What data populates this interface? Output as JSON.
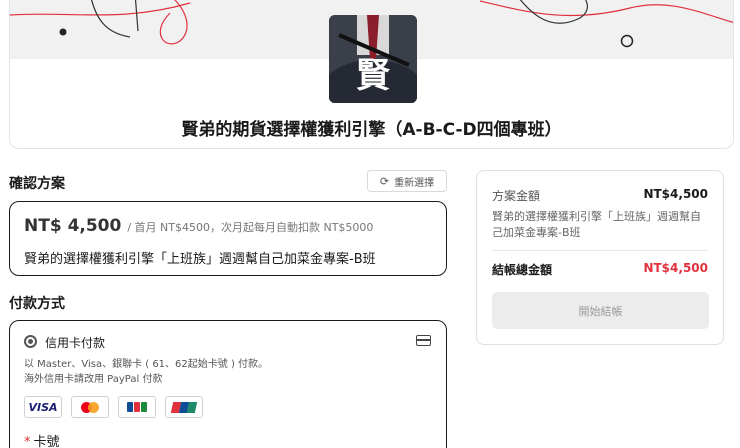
{
  "colors": {
    "accent_red": "#e0313d",
    "card_border": "#1a1a1a",
    "muted_bg": "#ececec"
  },
  "course": {
    "cover_glyph": "賢",
    "title": "賢弟的期貨選擇權獲利引擎（A-B-C-D四個專班）"
  },
  "confirm": {
    "section_title": "確認方案",
    "reselect_label": "重新選擇",
    "reselect_icon": "refresh-icon",
    "plan": {
      "price": "NT$ 4,500",
      "price_note": "/ 首月 NT$4500，次月起每月自動扣款 NT$5000",
      "name": "賢弟的選擇權獲利引擎「上班族」週週幫自己加菜金專案-B班"
    }
  },
  "payment": {
    "section_title": "付款方式",
    "method_label": "信用卡付款",
    "method_icon": "credit-card-icon",
    "desc_line1": "以 Master、Visa、銀聯卡 ( 61、62起始卡號 ) 付款。",
    "desc_line2": "海外信用卡請改用 PayPal 付款",
    "brands": [
      "VISA",
      "mastercard",
      "JCB",
      "UnionPay"
    ],
    "card_number_required": "*",
    "card_number_label": "卡號"
  },
  "summary": {
    "amount_label": "方案金額",
    "amount_value": "NT$4,500",
    "plan_desc": "賢弟的選擇權獲利引擎「上班族」週週幫自己加菜金專案-B班",
    "total_label": "結帳總金額",
    "total_value": "NT$4,500",
    "checkout_label": "開始結帳"
  }
}
